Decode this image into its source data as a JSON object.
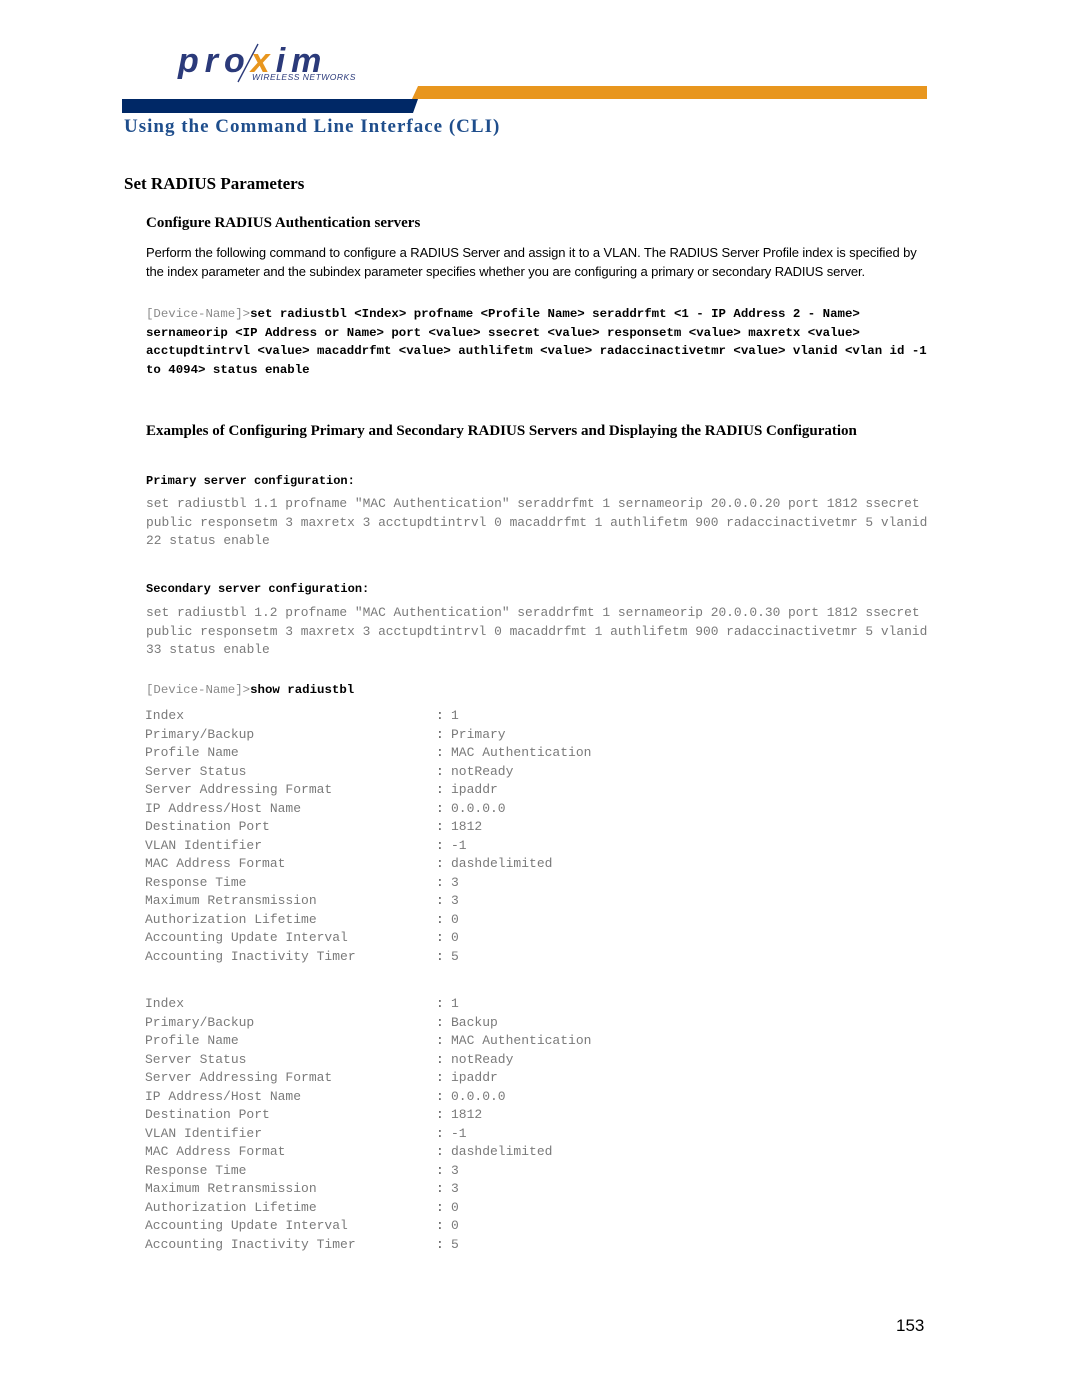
{
  "header": {
    "logo": {
      "brand": "pro",
      "brand_x": "x",
      "brand_end": "im",
      "tagline": "WIRELESS NETWORKS",
      "colors": {
        "navy": "#2b3a7a",
        "orange": "#e8961e"
      }
    },
    "band_colors": {
      "orange": "#e8961e",
      "navy": "#002866"
    },
    "chapter_title": "Using the Command Line Interface (CLI)"
  },
  "section": {
    "title": "Set RADIUS Parameters",
    "subsection_title": "Configure RADIUS Authentication servers",
    "description": "Perform the following command to configure a RADIUS Server and assign it to a VLAN. The RADIUS Server Profile index is specified by the index parameter and the subindex parameter specifies whether you are configuring a primary or secondary RADIUS server.",
    "syntax": {
      "prompt": "[Device-Name]>",
      "command": "set radiustbl <Index> profname <Profile Name> seraddrfmt <1 - IP Address 2 - Name> sernameorip <IP Address or Name> port <value> ssecret <value> responsetm <value> maxretx <value> acctupdtintrvl <value> macaddrfmt <value> authlifetm <value> radaccinactivetmr <value> vlanid <vlan id -1 to 4094> status enable"
    }
  },
  "examples": {
    "title": "Examples of Configuring Primary and Secondary RADIUS Servers and Displaying the RADIUS Configuration",
    "primary": {
      "label": "Primary server configuration:",
      "command": "set radiustbl 1.1 profname \"MAC Authentication\" seraddrfmt 1 sernameorip 20.0.0.20 port 1812 ssecret public responsetm 3 maxretx 3 acctupdtintrvl 0 macaddrfmt 1 authlifetm 900 radaccinactivetmr 5 vlanid 22 status enable"
    },
    "secondary": {
      "label": "Secondary server configuration:",
      "command": "set radiustbl 1.2 profname \"MAC Authentication\" seraddrfmt 1 sernameorip 20.0.0.30 port 1812 ssecret public responsetm 3 maxretx 3 acctupdtintrvl 0 macaddrfmt 1 authlifetm 900 radaccinactivetmr 5 vlanid 33 status enable"
    },
    "show": {
      "prompt": "[Device-Name]>",
      "command": "show radiustbl"
    },
    "separator": ":",
    "tables": [
      {
        "rows": [
          {
            "key": "Index",
            "value": "1"
          },
          {
            "key": "Primary/Backup",
            "value": "Primary"
          },
          {
            "key": "Profile Name",
            "value": "MAC Authentication"
          },
          {
            "key": "Server Status",
            "value": "notReady"
          },
          {
            "key": "Server Addressing Format",
            "value": "ipaddr"
          },
          {
            "key": "IP Address/Host Name",
            "value": "0.0.0.0"
          },
          {
            "key": "Destination Port",
            "value": "1812"
          },
          {
            "key": "VLAN Identifier",
            "value": "-1"
          },
          {
            "key": "MAC Address Format",
            "value": "dashdelimited"
          },
          {
            "key": "Response Time",
            "value": "3"
          },
          {
            "key": "Maximum Retransmission",
            "value": "3"
          },
          {
            "key": "Authorization Lifetime",
            "value": "0"
          },
          {
            "key": "Accounting Update Interval",
            "value": "0"
          },
          {
            "key": "Accounting Inactivity Timer",
            "value": "5"
          }
        ]
      },
      {
        "rows": [
          {
            "key": "Index",
            "value": "1"
          },
          {
            "key": "Primary/Backup",
            "value": "Backup"
          },
          {
            "key": "Profile Name",
            "value": "MAC Authentication"
          },
          {
            "key": "Server Status",
            "value": "notReady"
          },
          {
            "key": "Server Addressing Format",
            "value": "ipaddr"
          },
          {
            "key": "IP Address/Host Name",
            "value": "0.0.0.0"
          },
          {
            "key": "Destination Port",
            "value": "1812"
          },
          {
            "key": "VLAN Identifier",
            "value": "-1"
          },
          {
            "key": "MAC Address Format",
            "value": "dashdelimited"
          },
          {
            "key": "Response Time",
            "value": "3"
          },
          {
            "key": "Maximum Retransmission",
            "value": "3"
          },
          {
            "key": "Authorization Lifetime",
            "value": "0"
          },
          {
            "key": "Accounting Update Interval",
            "value": "0"
          },
          {
            "key": "Accounting Inactivity Timer",
            "value": "5"
          }
        ]
      }
    ]
  },
  "footer": {
    "page_number": "153"
  }
}
